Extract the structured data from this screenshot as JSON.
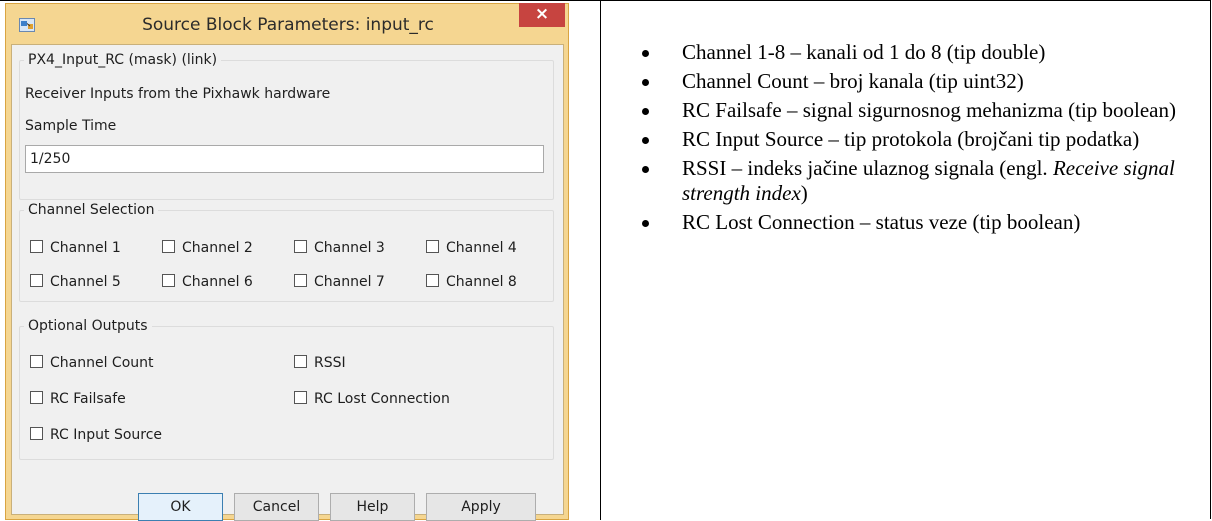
{
  "dialog": {
    "title": "Source Block Parameters: input_rc",
    "close_label": "×",
    "mask_group": {
      "legend": "PX4_Input_RC (mask) (link)",
      "description": "Receiver Inputs from the Pixhawk hardware",
      "sample_time_label": "Sample Time",
      "sample_time_value": "1/250"
    },
    "channel_selection": {
      "legend": "Channel Selection",
      "channels": [
        {
          "label": "Channel 1",
          "checked": false
        },
        {
          "label": "Channel 2",
          "checked": false
        },
        {
          "label": "Channel 3",
          "checked": false
        },
        {
          "label": "Channel 4",
          "checked": false
        },
        {
          "label": "Channel 5",
          "checked": false
        },
        {
          "label": "Channel 6",
          "checked": false
        },
        {
          "label": "Channel 7",
          "checked": false
        },
        {
          "label": "Channel 8",
          "checked": false
        }
      ]
    },
    "optional_outputs": {
      "legend": "Optional Outputs",
      "options": [
        {
          "label": "Channel Count",
          "checked": false
        },
        {
          "label": "RSSI",
          "checked": false
        },
        {
          "label": "RC Failsafe",
          "checked": false
        },
        {
          "label": "RC Lost Connection",
          "checked": false
        },
        {
          "label": "RC Input Source",
          "checked": false
        }
      ]
    },
    "buttons": {
      "ok": "OK",
      "cancel": "Cancel",
      "help": "Help",
      "apply": "Apply"
    }
  },
  "bullets": [
    {
      "text": "Channel 1-8 – kanali od 1 do 8 (tip double)"
    },
    {
      "text": "Channel Count – broj kanala (tip uint32)"
    },
    {
      "text": "RC Failsafe – signal sigurnosnog mehanizma (tip boolean)"
    },
    {
      "text": "RC Input Source – tip protokola (brojčani tip podatka)"
    },
    {
      "pre": "RSSI – indeks jačine ulaznog signala (engl. ",
      "italic": "Receive signal strength index",
      "post": ")"
    },
    {
      "text": "RC Lost Connection – status veze (tip boolean)"
    }
  ],
  "colors": {
    "window_frame": "#f5d691",
    "close_button": "#c74440",
    "dialog_body": "#f0f0f0"
  }
}
